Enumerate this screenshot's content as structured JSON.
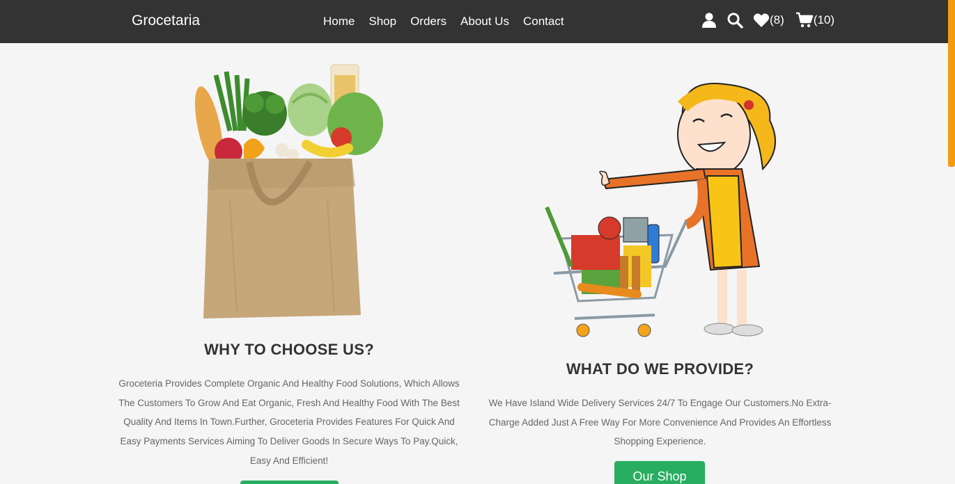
{
  "navbar": {
    "logo": "Grocetaria",
    "links": [
      "Home",
      "Shop",
      "Orders",
      "About Us",
      "Contact"
    ],
    "wishlist_count": "(8)",
    "cart_count": "(10)",
    "icons": [
      "user-icon",
      "search-icon",
      "heart-icon",
      "cart-icon"
    ]
  },
  "section_left": {
    "heading": "WHY TO CHOOSE US?",
    "text": "Groceteria Provides Complete Organic And Healthy Food Solutions, Which Allows The Customers To Grow And Eat Organic, Fresh And Healthy Food With The Best Quality And Items In Town.Further, Groceteria Provides Features For Quick And Easy Payments Services Aiming To Deliver Goods In Secure Ways To Pay.Quick, Easy And Efficient!"
  },
  "section_right": {
    "heading": "WHAT DO WE PROVIDE?",
    "text": "We Have Island Wide Delivery Services 24/7 To Engage Our Customers.No Extra-Charge Added Just A Free Way For More Convenience And Provides An Effortless Shopping Experience.",
    "button": "Our Shop"
  },
  "colors": {
    "navbar": "#333333",
    "accent_green": "#27ae60",
    "scroll_thumb": "#f39c12",
    "background": "#f5f5f5"
  }
}
